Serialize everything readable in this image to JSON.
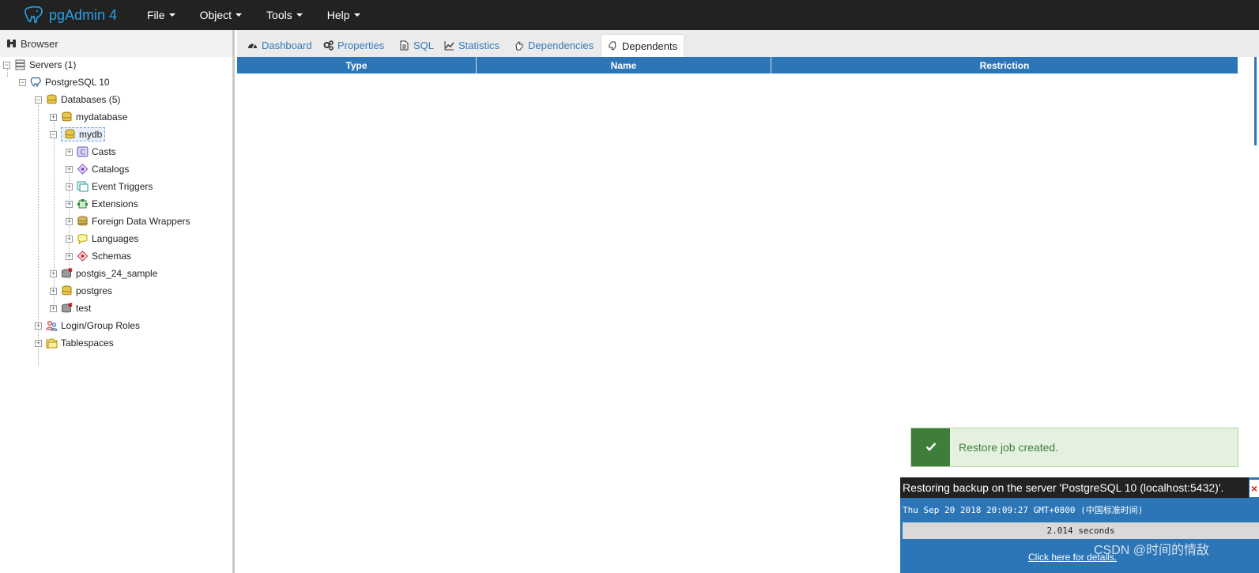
{
  "app": {
    "title": "pgAdmin 4"
  },
  "menu": [
    {
      "label": "File"
    },
    {
      "label": "Object"
    },
    {
      "label": "Tools"
    },
    {
      "label": "Help"
    }
  ],
  "browser": {
    "title": "Browser",
    "tree": [
      {
        "label": "Servers (1)",
        "icon": "servers-icon",
        "level": 0,
        "expanded": true
      },
      {
        "label": "PostgreSQL 10",
        "icon": "elephant-server-icon",
        "level": 1,
        "expanded": true
      },
      {
        "label": "Databases (5)",
        "icon": "databases-icon",
        "level": 2,
        "expanded": true
      },
      {
        "label": "mydatabase",
        "icon": "database-icon",
        "level": 3,
        "expanded": false
      },
      {
        "label": "mydb",
        "icon": "database-icon",
        "level": 3,
        "expanded": true,
        "selected": true
      },
      {
        "label": "Casts",
        "icon": "casts-icon",
        "level": 4,
        "expanded": false
      },
      {
        "label": "Catalogs",
        "icon": "catalogs-icon",
        "level": 4,
        "expanded": false
      },
      {
        "label": "Event Triggers",
        "icon": "event-triggers-icon",
        "level": 4,
        "expanded": false
      },
      {
        "label": "Extensions",
        "icon": "extensions-icon",
        "level": 4,
        "expanded": false
      },
      {
        "label": "Foreign Data Wrappers",
        "icon": "foreign-data-wrappers-icon",
        "level": 4,
        "expanded": false
      },
      {
        "label": "Languages",
        "icon": "languages-icon",
        "level": 4,
        "expanded": false
      },
      {
        "label": "Schemas",
        "icon": "schemas-icon",
        "level": 4,
        "expanded": false
      },
      {
        "label": "postgis_24_sample",
        "icon": "database-disconnected-icon",
        "level": 3,
        "expanded": false
      },
      {
        "label": "postgres",
        "icon": "database-icon",
        "level": 3,
        "expanded": false
      },
      {
        "label": "test",
        "icon": "database-disconnected-icon",
        "level": 3,
        "expanded": false
      },
      {
        "label": "Login/Group Roles",
        "icon": "roles-icon",
        "level": 2,
        "expanded": false
      },
      {
        "label": "Tablespaces",
        "icon": "tablespaces-icon",
        "level": 2,
        "expanded": false
      }
    ]
  },
  "tabs": [
    {
      "label": "Dashboard",
      "icon": "dashboard-icon"
    },
    {
      "label": "Properties",
      "icon": "properties-icon"
    },
    {
      "label": "SQL",
      "icon": "sql-icon"
    },
    {
      "label": "Statistics",
      "icon": "statistics-icon"
    },
    {
      "label": "Dependencies",
      "icon": "dependencies-icon"
    },
    {
      "label": "Dependents",
      "icon": "dependents-icon",
      "active": true
    }
  ],
  "grid": {
    "columns": [
      "Type",
      "Name",
      "Restriction"
    ],
    "rows": []
  },
  "toast": {
    "message": "Restore job created.",
    "icon": "check-icon"
  },
  "process": {
    "title": "Restoring backup on the server 'PostgreSQL 10 (localhost:5432)'.",
    "close_label": "×",
    "time": "Thu Sep 20 2018 20:09:27 GMT+0800 (中国标准时间)",
    "duration": "2.014 seconds",
    "details_link": "Click here for details."
  },
  "watermark": "CSDN @时间的情敌",
  "colors": {
    "navbar": "#222222",
    "brand": "#2c9fe3",
    "grid_header": "#2c76b8",
    "link": "#337ab7",
    "success": "#3e7d3a",
    "success_bg": "#e4f1df"
  }
}
